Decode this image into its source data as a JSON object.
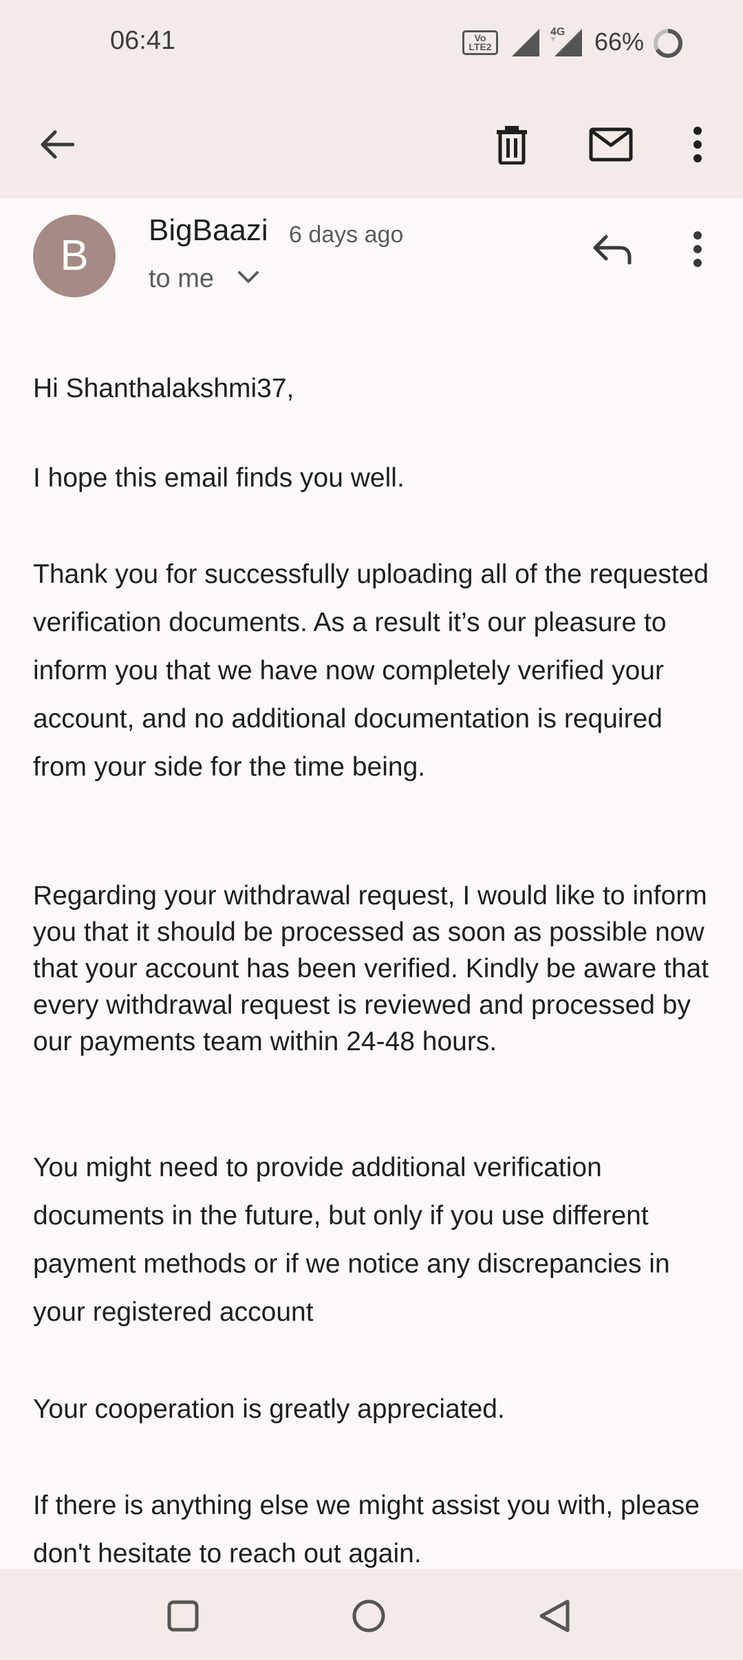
{
  "status_bar": {
    "time": "06:41",
    "volte_label": "Vo LTE 2",
    "network_label": "4G",
    "battery": "66%"
  },
  "toolbar": {
    "back_icon": "arrow-left-icon",
    "delete_icon": "trash-icon",
    "mark_unread_icon": "mail-icon",
    "more_icon": "more-vert-icon"
  },
  "email": {
    "avatar_letter": "B",
    "avatar_color": "#a58b84",
    "sender": "BigBaazi",
    "time_ago": "6 days ago",
    "recipient": "to me",
    "paragraphs": [
      "Hi Shanthalakshmi37,",
      "I hope this email finds you well.",
      "Thank you for successfully uploading all of the requested verification documents. As a result it’s our pleasure to inform you that we have now completely verified your account, and no additional documentation is required from your side for the time being.",
      "Regarding your withdrawal request, I would like to inform you that it should be processed as soon as possible now that your account has been verified. Kindly be aware that every withdrawal request is reviewed and processed by our payments team within 24-48 hours.",
      "You might need to provide additional verification documents in the future, but only if you use different payment methods or if we notice any discrepancies in your registered account",
      "Your cooperation is greatly appreciated.",
      "If there is anything else we might assist you with, please don't hesitate to reach out again."
    ]
  },
  "nav_bar": {
    "recents_icon": "square-icon",
    "home_icon": "circle-icon",
    "back_icon": "triangle-back-icon"
  }
}
